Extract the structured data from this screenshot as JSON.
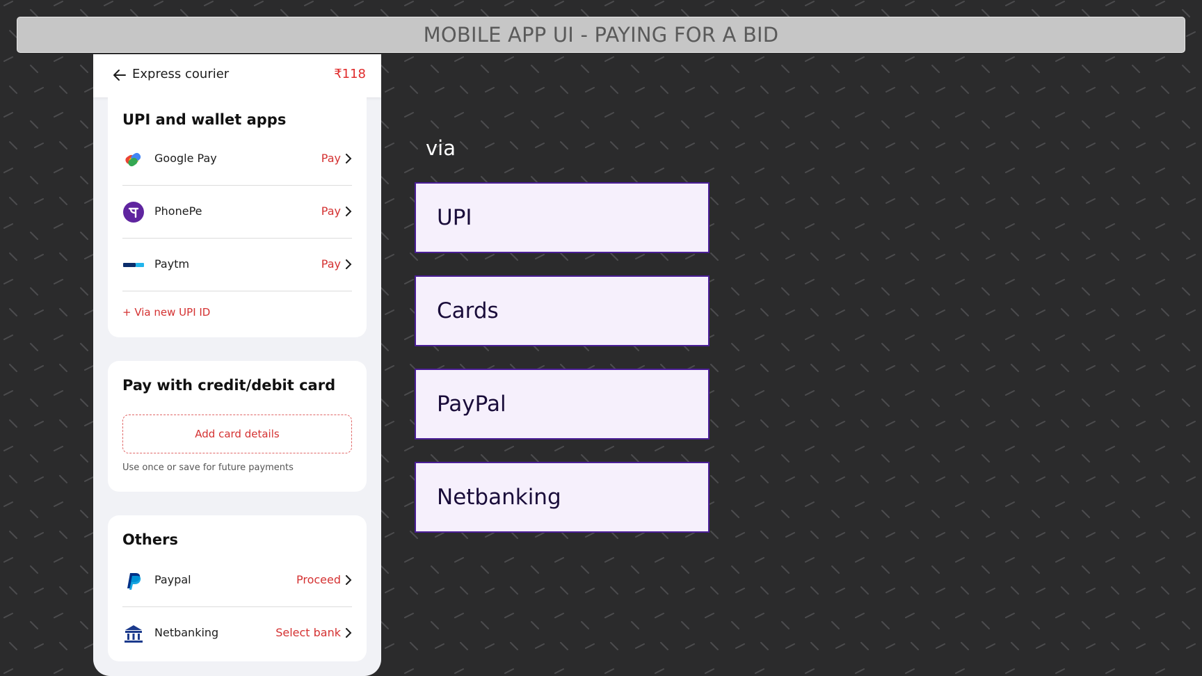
{
  "title": "MOBILE APP UI - PAYING FOR A BID",
  "header": {
    "back_icon": "arrow-left-icon",
    "title": "Express courier",
    "price": "₹118"
  },
  "upi_section": {
    "title": "UPI and wallet apps",
    "items": [
      {
        "label": "Google Pay",
        "action": "Pay",
        "icon": "google-pay-icon"
      },
      {
        "label": "PhonePe",
        "action": "Pay",
        "icon": "phonepe-icon"
      },
      {
        "label": "Paytm",
        "action": "Pay",
        "icon": "paytm-icon"
      }
    ],
    "new_upi_link": "+ Via new UPI ID"
  },
  "card_section": {
    "title": "Pay with credit/debit card",
    "add_button": "Add card details",
    "hint": "Use once or save for future payments"
  },
  "others_section": {
    "title": "Others",
    "items": [
      {
        "label": "Paypal",
        "action": "Proceed",
        "icon": "paypal-icon"
      },
      {
        "label": "Netbanking",
        "action": "Select bank",
        "icon": "bank-icon"
      }
    ]
  },
  "annotation": {
    "via": "via",
    "methods": [
      "UPI",
      "Cards",
      "PayPal",
      "Netbanking"
    ]
  },
  "colors": {
    "accent": "#d43131",
    "page_bg": "#2b2b2c",
    "method_border": "#4a1e96",
    "method_fill": "#f6f0fc"
  }
}
